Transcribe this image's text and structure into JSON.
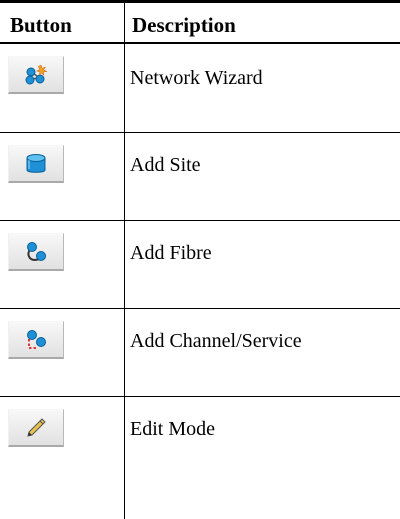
{
  "table": {
    "headers": {
      "button": "Button",
      "description": "Description"
    },
    "rows": [
      {
        "icon": "network-wizard-icon",
        "description": " Network Wizard"
      },
      {
        "icon": "add-site-icon",
        "description": "Add Site"
      },
      {
        "icon": "add-fibre-icon",
        "description": "Add Fibre"
      },
      {
        "icon": "add-channel-service-icon",
        "description": "Add Channel/Service"
      },
      {
        "icon": "edit-mode-icon",
        "description": "Edit Mode"
      }
    ]
  },
  "colors": {
    "node_blue": "#1e90d6",
    "link_red": "#e02020",
    "spark_orange": "#f0a020",
    "pencil_yellow": "#e8c24a"
  }
}
